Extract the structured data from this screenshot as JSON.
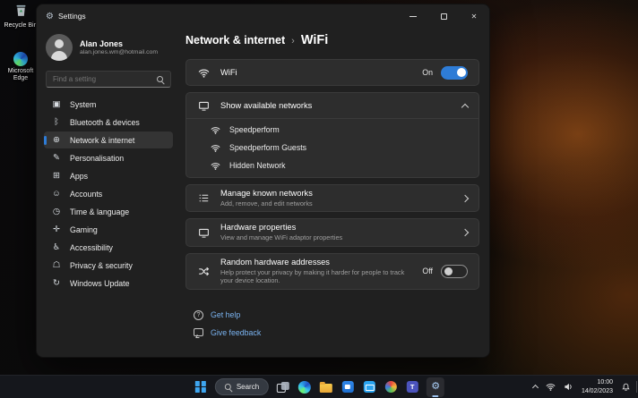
{
  "colors": {
    "accent": "#2e7cd6",
    "link": "#7ab3f0"
  },
  "desktop": {
    "icons": [
      {
        "label": "Recycle Bin"
      },
      {
        "label": "Microsoft Edge"
      }
    ]
  },
  "window": {
    "title": "Settings",
    "controls": {
      "minimize": "minimize",
      "maximize": "maximize",
      "close": "✕"
    },
    "user": {
      "name": "Alan Jones",
      "email": "alan.jones.wm@hotmail.com"
    },
    "search": {
      "placeholder": "Find a setting"
    },
    "nav": [
      {
        "label": "System",
        "glyph": "▣"
      },
      {
        "label": "Bluetooth & devices",
        "glyph": "ᛒ"
      },
      {
        "label": "Network & internet",
        "glyph": "⊕"
      },
      {
        "label": "Personalisation",
        "glyph": "✎"
      },
      {
        "label": "Apps",
        "glyph": "⊞"
      },
      {
        "label": "Accounts",
        "glyph": "☺"
      },
      {
        "label": "Time & language",
        "glyph": "◷"
      },
      {
        "label": "Gaming",
        "glyph": "✛"
      },
      {
        "label": "Accessibility",
        "glyph": "♿"
      },
      {
        "label": "Privacy & security",
        "glyph": "☖"
      },
      {
        "label": "Windows Update",
        "glyph": "↻"
      }
    ],
    "breadcrumb": {
      "parent": "Network & internet",
      "sep": "›",
      "title": "WiFi"
    },
    "wifi": {
      "label": "WiFi",
      "state": "On"
    },
    "networks": {
      "header": "Show available networks",
      "items": [
        "Speedperform",
        "Speedperform Guests",
        "Hidden Network"
      ]
    },
    "manage": {
      "title": "Manage known networks",
      "subtitle": "Add, remove, and edit networks"
    },
    "hardware": {
      "title": "Hardware properties",
      "subtitle": "View and manage WiFi adaptor properties"
    },
    "random": {
      "title": "Random hardware addresses",
      "subtitle": "Help protect your privacy by making it harder for people to track your device location.",
      "state": "Off"
    },
    "links": {
      "help": "Get help",
      "feedback": "Give feedback",
      "help_glyph": "?"
    }
  },
  "taskbar": {
    "search": "Search",
    "teams_letter": "T",
    "clock": {
      "time": "10:00",
      "date": "14/02/2023"
    }
  }
}
